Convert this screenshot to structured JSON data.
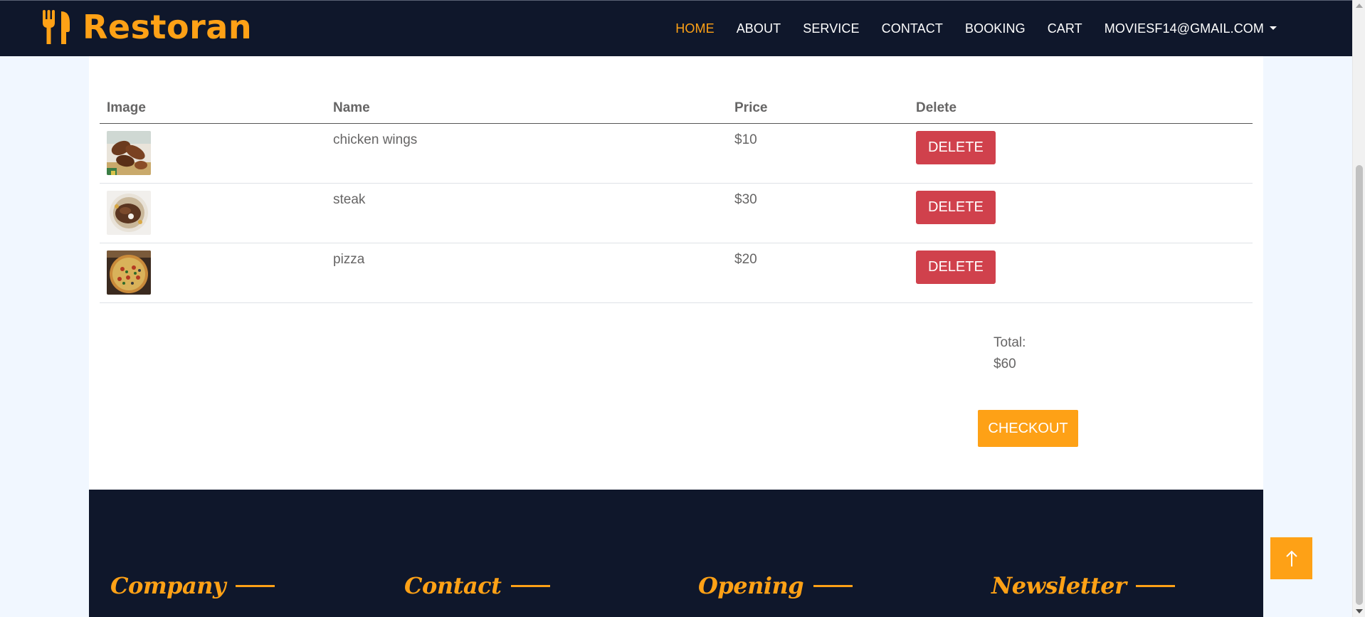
{
  "brand": {
    "name": "Restoran",
    "icon": "utensils-icon"
  },
  "nav": {
    "items": [
      {
        "label": "HOME",
        "active": true
      },
      {
        "label": "ABOUT",
        "active": false
      },
      {
        "label": "SERVICE",
        "active": false
      },
      {
        "label": "CONTACT",
        "active": false
      },
      {
        "label": "BOOKING",
        "active": false
      },
      {
        "label": "CART",
        "active": false
      }
    ],
    "user": "MOVIESF14@GMAIL.COM"
  },
  "cart": {
    "headers": {
      "image": "Image",
      "name": "Name",
      "price": "Price",
      "delete": "Delete"
    },
    "rows": [
      {
        "name": "chicken wings",
        "price": "$10",
        "image": "chicken-wings-image",
        "delete_label": "DELETE"
      },
      {
        "name": "steak",
        "price": "$30",
        "image": "steak-image",
        "delete_label": "DELETE"
      },
      {
        "name": "pizza",
        "price": "$20",
        "image": "pizza-image",
        "delete_label": "DELETE"
      }
    ],
    "total_label": "Total:",
    "total_value": "$60",
    "checkout_label": "CHECKOUT"
  },
  "footer": {
    "headings": [
      "Company",
      "Contact",
      "Opening",
      "Newsletter"
    ]
  },
  "colors": {
    "primary": "#fea116",
    "dark": "#0f172b",
    "danger": "#d0414c",
    "text": "#666565",
    "page_bg": "#f1f7ff"
  }
}
